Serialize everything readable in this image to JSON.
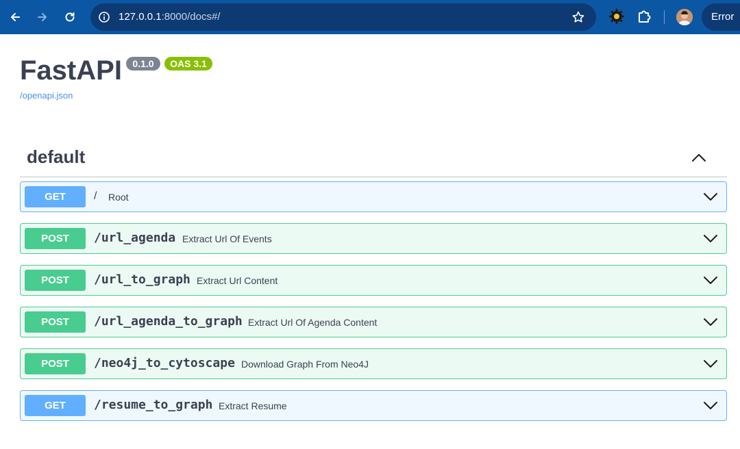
{
  "browser": {
    "url_host": "127.0.0.1",
    "url_rest": ":8000/docs#/",
    "profile_status": "Error"
  },
  "api": {
    "title": "FastAPI",
    "version": "0.1.0",
    "oas_version": "OAS 3.1",
    "spec_link": "/openapi.json"
  },
  "section": {
    "name": "default",
    "expanded": true
  },
  "operations": [
    {
      "method": "GET",
      "path": "/",
      "summary": "Root"
    },
    {
      "method": "POST",
      "path": "/url_agenda",
      "summary": "Extract Url Of Events"
    },
    {
      "method": "POST",
      "path": "/url_to_graph",
      "summary": "Extract Url Content"
    },
    {
      "method": "POST",
      "path": "/url_agenda_to_graph",
      "summary": "Extract Url Of Agenda Content"
    },
    {
      "method": "POST",
      "path": "/neo4j_to_cytoscape",
      "summary": "Download Graph From Neo4J"
    },
    {
      "method": "GET",
      "path": "/resume_to_graph",
      "summary": "Extract Resume"
    }
  ],
  "colors": {
    "chrome": "#0b57a4",
    "get": "#61affe",
    "post": "#49cc90",
    "version_badge": "#7d8492",
    "oas_badge": "#89bf04",
    "link": "#4990e2"
  },
  "icons": {
    "back": "arrow-left-icon",
    "forward": "arrow-right-icon",
    "reload": "reload-icon",
    "site_info": "site-info-icon",
    "bookmark": "star-icon",
    "extension": "extension-gear-icon",
    "extensions_menu": "puzzle-icon",
    "collapse": "chevron-up-icon",
    "expand": "chevron-down-icon"
  }
}
